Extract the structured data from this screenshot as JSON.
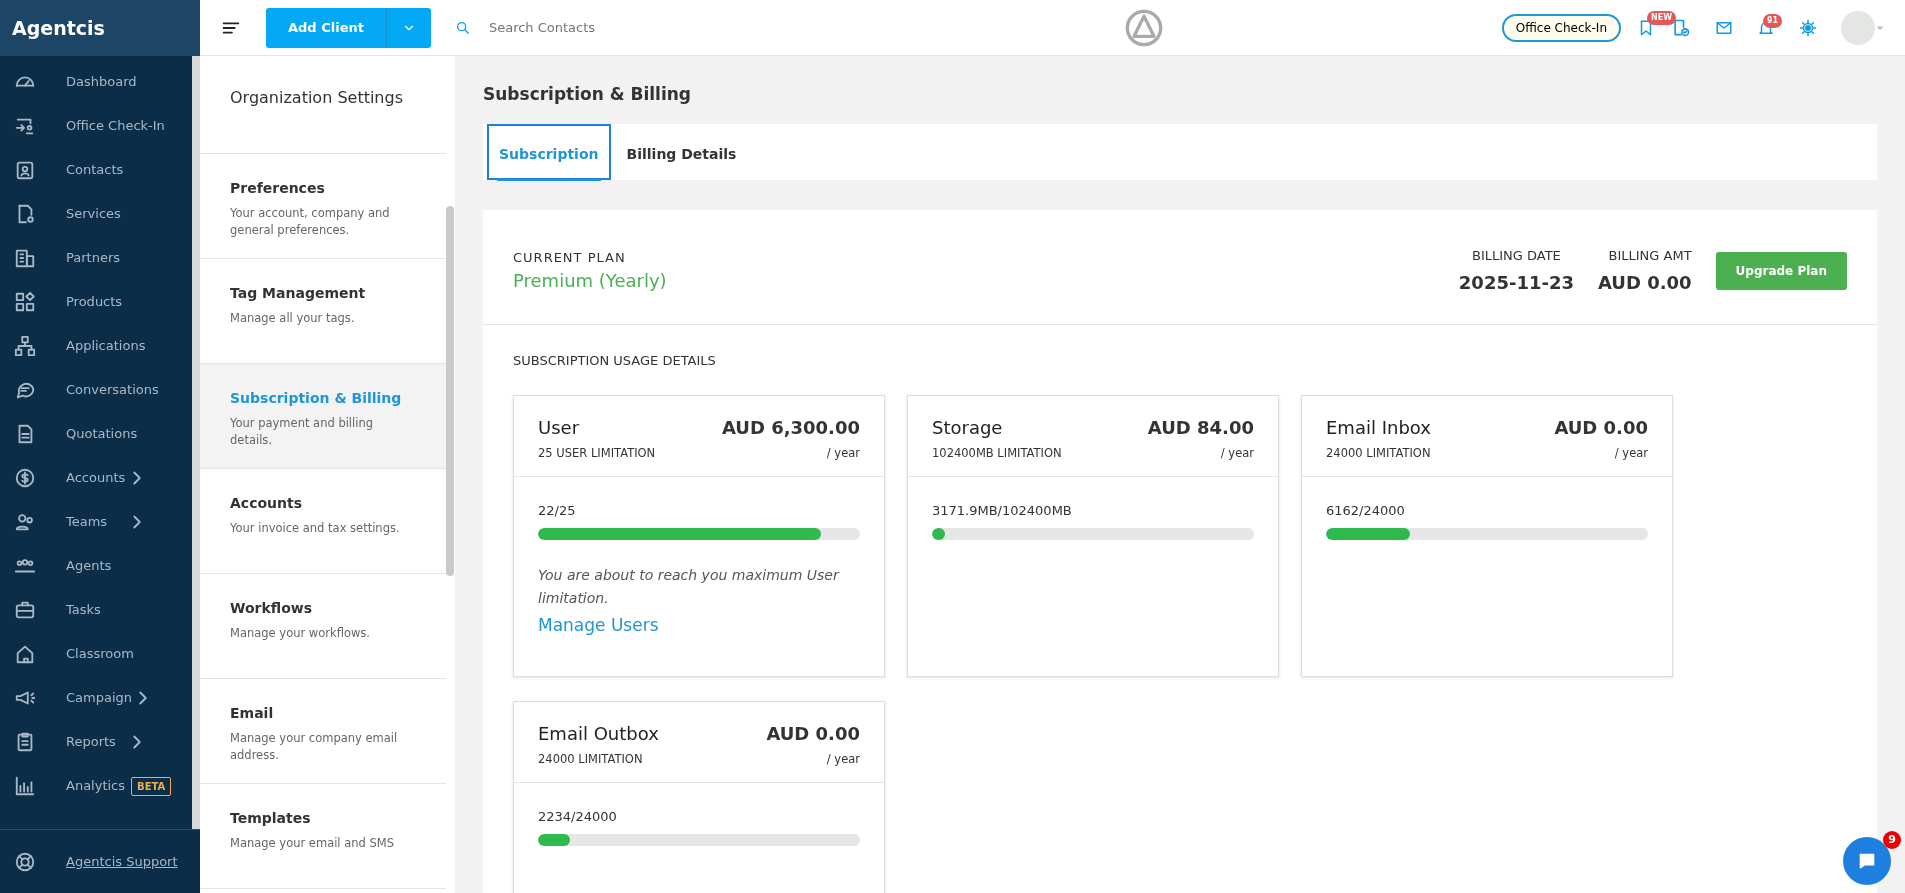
{
  "brand": "Agentcis",
  "sidebar": {
    "items": [
      {
        "label": "Dashboard",
        "expandable": false
      },
      {
        "label": "Office Check-In",
        "expandable": false
      },
      {
        "label": "Contacts",
        "expandable": false
      },
      {
        "label": "Services",
        "expandable": false
      },
      {
        "label": "Partners",
        "expandable": false
      },
      {
        "label": "Products",
        "expandable": false
      },
      {
        "label": "Applications",
        "expandable": false
      },
      {
        "label": "Conversations",
        "expandable": false
      },
      {
        "label": "Quotations",
        "expandable": false
      },
      {
        "label": "Accounts",
        "expandable": true
      },
      {
        "label": "Teams",
        "expandable": true
      },
      {
        "label": "Agents",
        "expandable": false
      },
      {
        "label": "Tasks",
        "expandable": false
      },
      {
        "label": "Classroom",
        "expandable": false
      },
      {
        "label": "Campaign",
        "expandable": true
      },
      {
        "label": "Reports",
        "expandable": true
      },
      {
        "label": "Analytics",
        "expandable": false,
        "badge": "BETA"
      }
    ],
    "footer": "Agentcis Support"
  },
  "topbar": {
    "add_button": "Add Client",
    "search": {
      "placeholder": "Search Contacts"
    },
    "checkin_button": "Office Check-In",
    "new_badge": "NEW",
    "notification_count": "91"
  },
  "settings_nav": {
    "title": "Organization Settings",
    "items": [
      {
        "title": "Preferences",
        "description": "Your account, company and general preferences.",
        "selected": false
      },
      {
        "title": "Tag Management",
        "description": "Manage all your tags.",
        "selected": false
      },
      {
        "title": "Subscription & Billing",
        "description": "Your payment and billing details.",
        "selected": true
      },
      {
        "title": "Accounts",
        "description": "Your invoice and tax settings.",
        "selected": false
      },
      {
        "title": "Workflows",
        "description": "Manage your workflows.",
        "selected": false
      },
      {
        "title": "Email",
        "description": "Manage your company email address.",
        "selected": false
      },
      {
        "title": "Templates",
        "description": "Manage your email and SMS",
        "selected": false
      }
    ]
  },
  "page_title": "Subscription & Billing",
  "tabs": [
    {
      "label": "Subscription",
      "selected": true
    },
    {
      "label": "Billing Details",
      "selected": false
    }
  ],
  "plan": {
    "label": "CURRENT PLAN",
    "name": "Premium (Yearly)",
    "billing_date_label": "BILLING DATE",
    "billing_date": "2025-11-23",
    "billing_amt_label": "BILLING AMT",
    "billing_amt": "AUD 0.00",
    "upgrade_button": "Upgrade Plan"
  },
  "usage": {
    "title": "SUBSCRIPTION USAGE DETAILS",
    "cards": [
      {
        "name": "User",
        "price": "AUD 6,300.00",
        "limit": "25 USER LIMITATION",
        "period": "/ year",
        "usage": "22/25",
        "level": 0.88,
        "note": "You are about to reach you maximum User limitation.",
        "link": "Manage Users"
      },
      {
        "name": "Storage",
        "price": "AUD 84.00",
        "limit": "102400MB LIMITATION",
        "period": "/ year",
        "usage": "3171.9MB/102400MB",
        "level": 0.04
      },
      {
        "name": "Email Inbox",
        "price": "AUD 0.00",
        "limit": "24000 LIMITATION",
        "period": "/ year",
        "usage": "6162/24000",
        "level": 0.26
      },
      {
        "name": "Email Outbox",
        "price": "AUD 0.00",
        "limit": "24000 LIMITATION",
        "period": "/ year",
        "usage": "2234/24000",
        "level": 0.1
      }
    ]
  },
  "chat_badge": "9"
}
